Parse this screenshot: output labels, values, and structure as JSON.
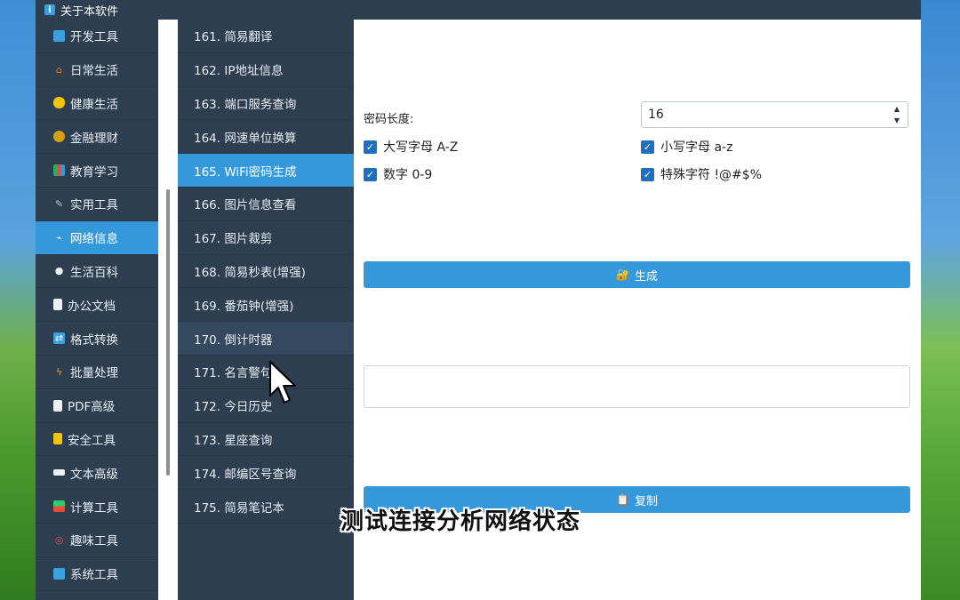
{
  "window": {
    "title": "关于本软件"
  },
  "sidebar": {
    "items": [
      {
        "label": "开发工具",
        "icon": "monitor-icon",
        "color": "#3aa0e0"
      },
      {
        "label": "日常生活",
        "icon": "house-icon",
        "color": "#e67e22"
      },
      {
        "label": "健康生活",
        "icon": "muscle-icon",
        "color": "#f1c40f"
      },
      {
        "label": "金融理财",
        "icon": "money-bag-icon",
        "color": "#d4a017"
      },
      {
        "label": "教育学习",
        "icon": "books-icon",
        "color": "#27ae60"
      },
      {
        "label": "实用工具",
        "icon": "tools-icon",
        "color": "#bdc3c7"
      },
      {
        "label": "网络信息",
        "icon": "satellite-icon",
        "color": "#ecf0f1"
      },
      {
        "label": "生活百科",
        "icon": "dot-icon",
        "color": "#ecf0f1"
      },
      {
        "label": "办公文档",
        "icon": "document-icon",
        "color": "#ecf0f1"
      },
      {
        "label": "格式转换",
        "icon": "convert-icon",
        "color": "#3aa0e0"
      },
      {
        "label": "批量处理",
        "icon": "lightning-icon",
        "color": "#f39c12"
      },
      {
        "label": "PDF高级",
        "icon": "pdf-icon",
        "color": "#ecf0f1"
      },
      {
        "label": "安全工具",
        "icon": "lock-icon",
        "color": "#f1c40f"
      },
      {
        "label": "文本高级",
        "icon": "keyboard-icon",
        "color": "#ecf0f1"
      },
      {
        "label": "计算工具",
        "icon": "calculator-icon",
        "color": "#2ecc71"
      },
      {
        "label": "趣味工具",
        "icon": "target-icon",
        "color": "#e74c3c"
      },
      {
        "label": "系统工具",
        "icon": "computer-icon",
        "color": "#3aa0e0"
      }
    ],
    "active_index": 6
  },
  "tools": {
    "items": [
      "161. 简易翻译",
      "162. IP地址信息",
      "163. 端口服务查询",
      "164. 网速单位换算",
      "165. WiFi密码生成",
      "166. 图片信息查看",
      "167. 图片裁剪",
      "168. 简易秒表(增强)",
      "169. 番茄钟(增强)",
      "170. 倒计时器",
      "171. 名言警句",
      "172. 今日历史",
      "173. 星座查询",
      "174. 邮编区号查询",
      "175. 简易笔记本"
    ],
    "active_index": 4,
    "hover_index": 9
  },
  "form": {
    "length_label": "密码长度:",
    "length_value": "16",
    "checkboxes": {
      "upper": "大写字母 A-Z",
      "lower": "小写字母 a-z",
      "digits": "数字 0-9",
      "special": "特殊字符 !@#$%"
    },
    "generate_label": "生成",
    "output_value": "",
    "copy_label": "复制"
  },
  "overlay": {
    "subtitle": "测试连接分析网络状态"
  },
  "colors": {
    "accent": "#3498db",
    "sidebar_bg": "#2c3e50",
    "checkbox": "#1f6fbf"
  }
}
